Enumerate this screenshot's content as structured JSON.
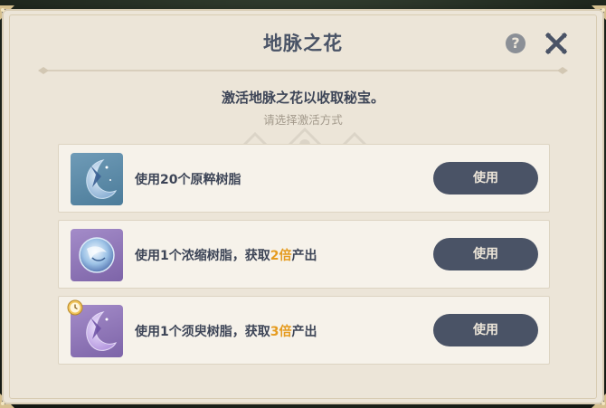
{
  "dialog": {
    "title": "地脉之花",
    "help_label": "?",
    "subtitle": "激活地脉之花以收取秘宝。",
    "hint": "请选择激活方式"
  },
  "options": [
    {
      "icon": "original-resin-icon",
      "text_prefix": "使用20个原粹树脂",
      "text_highlight": "",
      "text_suffix": "",
      "button_label": "使用"
    },
    {
      "icon": "condensed-resin-icon",
      "text_prefix": "使用1个浓缩树脂，获取",
      "text_highlight": "2倍",
      "text_suffix": "产出",
      "button_label": "使用"
    },
    {
      "icon": "transient-resin-icon",
      "text_prefix": "使用1个须臾树脂，获取",
      "text_highlight": "3倍",
      "text_suffix": "产出",
      "button_label": "使用"
    }
  ],
  "colors": {
    "panel_bg": "#ece5d8",
    "title_text": "#495366",
    "highlight": "#e59b1f",
    "button_bg": "#4a5366",
    "button_text": "#ece5d8"
  }
}
